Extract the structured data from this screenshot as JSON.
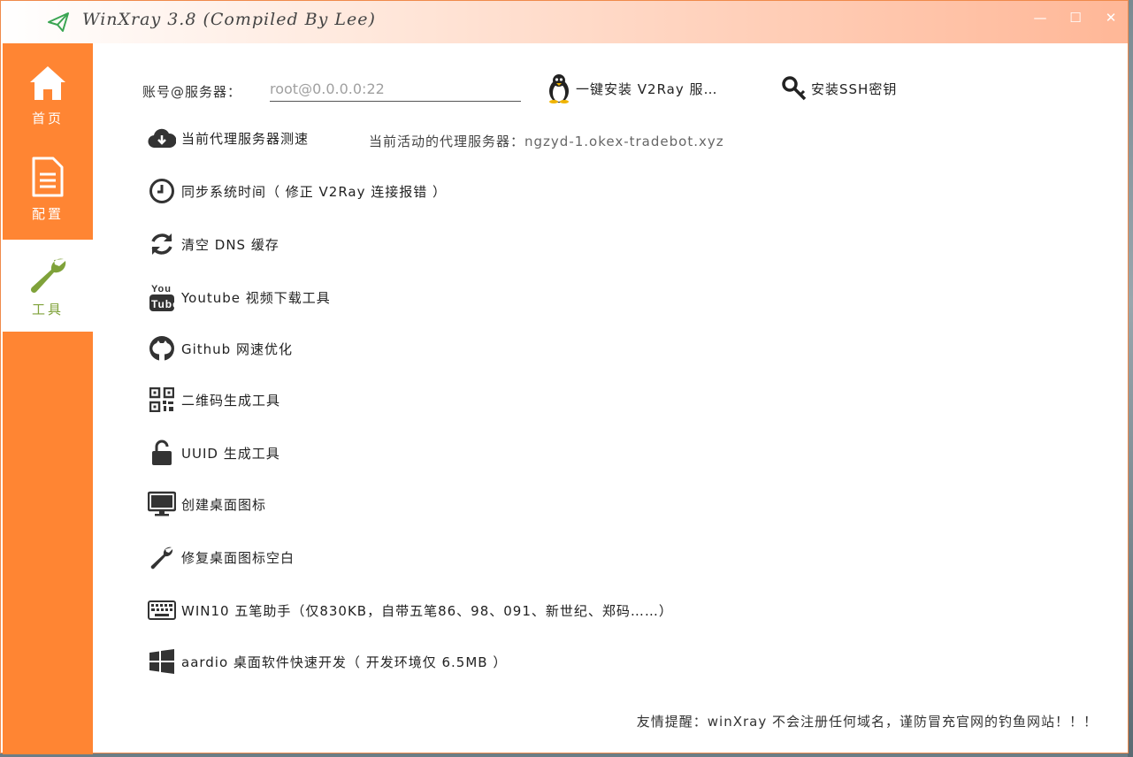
{
  "window": {
    "title": "WinXray 3.8 (Compiled By Lee)",
    "controls": {
      "minimize": "—",
      "maximize": "☐",
      "close": "✕"
    }
  },
  "sidebar": {
    "items": [
      {
        "label": "首页",
        "icon": "home-icon",
        "active": false
      },
      {
        "label": "配置",
        "icon": "document-icon",
        "active": false
      },
      {
        "label": "工具",
        "icon": "wrench-icon",
        "active": true
      }
    ]
  },
  "account": {
    "label": "账号@服务器：",
    "placeholder": "root@0.0.0.0:22"
  },
  "top_actions": {
    "install_v2ray": "一键安装 V2Ray 服…",
    "install_ssh": "安装SSH密钥"
  },
  "proxy": {
    "active_label": "当前活动的代理服务器：",
    "active_host": "ngzyd-1.okex-tradebot.xyz"
  },
  "tools": [
    {
      "label": "当前代理服务器测速",
      "icon": "cloud-download-icon"
    },
    {
      "label": "同步系统时间（ 修正 V2Ray 连接报错 ）",
      "icon": "clock-icon"
    },
    {
      "label": "清空 DNS 缓存",
      "icon": "refresh-icon"
    },
    {
      "label": "Youtube 视频下载工具",
      "icon": "youtube-icon"
    },
    {
      "label": "Github 网速优化",
      "icon": "github-icon"
    },
    {
      "label": "二维码生成工具",
      "icon": "qrcode-icon"
    },
    {
      "label": "UUID 生成工具",
      "icon": "unlock-icon"
    },
    {
      "label": "创建桌面图标",
      "icon": "monitor-icon"
    },
    {
      "label": "修复桌面图标空白",
      "icon": "wrench-icon"
    },
    {
      "label": "WIN10 五笔助手（仅830KB，自带五笔86、98、091、新世纪、郑码……）",
      "icon": "keyboard-icon"
    },
    {
      "label": "aardio 桌面软件快速开发（ 开发环境仅 6.5MB ）",
      "icon": "windows-icon"
    }
  ],
  "footer": {
    "note": "友情提醒：winXray 不会注册任何域名，谨防冒充官网的钓鱼网站！！！"
  },
  "colors": {
    "sidebar": "#ff8533",
    "active_label": "#7fa23a",
    "titlebar_gradient_end": "#ffb797"
  }
}
